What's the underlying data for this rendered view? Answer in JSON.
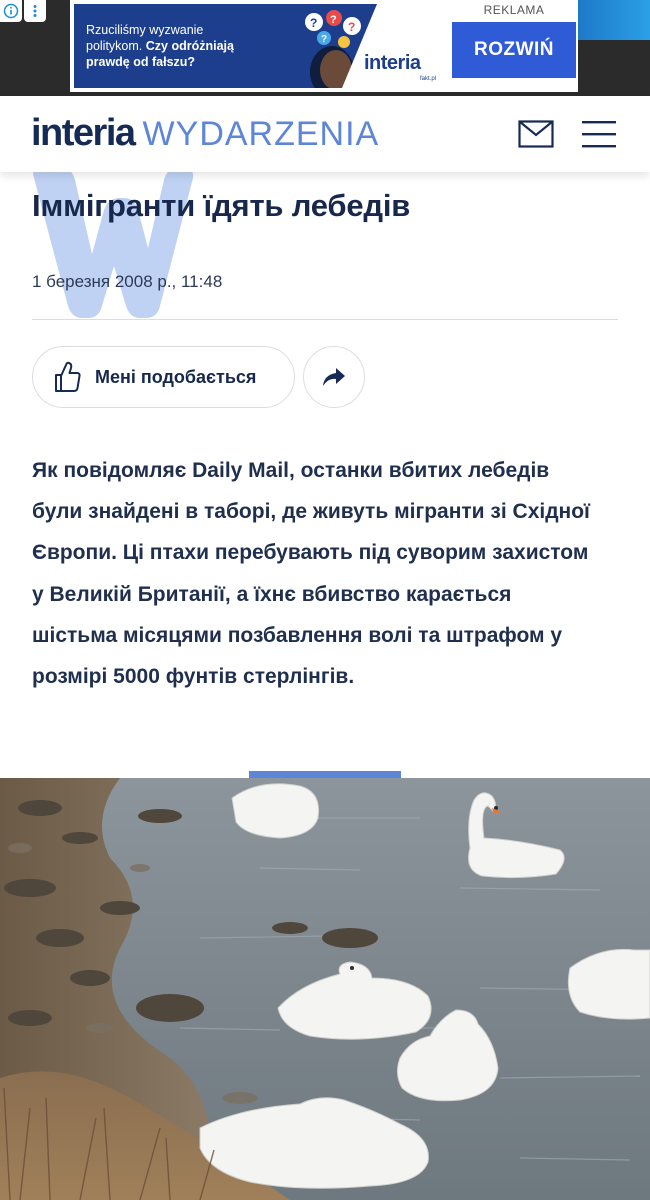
{
  "ad": {
    "teaser_line1": "Rzuciliśmy wyzwanie",
    "teaser_line2": "politykom.",
    "teaser_bold1": "Czy odróżniają",
    "teaser_bold2": "prawdę od fałszu?",
    "brand": "interia",
    "brand_sub": "fakt.pl",
    "sponsored_label": "REKLAMA",
    "cta_label": "ROZWIŃ",
    "info_icon": "info-icon",
    "more_icon": "more-vertical-icon"
  },
  "header": {
    "logo_main": "interia",
    "logo_section": "WYDARZENIA",
    "mail_icon": "mail-icon",
    "menu_icon": "hamburger-menu-icon"
  },
  "article": {
    "title": "Іммігранти їдять лебедів",
    "date": "1 березня 2008 р., 11:48",
    "like_label": "Мені подобається",
    "lead": "Як повідомляє Daily Mail, останки вбитих лебедів були знайдені в таборі, де живуть мігранти зі Східної Європи. Ці птахи перебувають під суворим захистом у Великій Британії, а їхнє вбивство карається шістьма місяцями позбавлення волі та штрафом у розмірі 5000 фунтів стерлінгів."
  },
  "colors": {
    "accent": "#5e86d8",
    "navy": "#152a55",
    "ad_blue": "#2f5bd6"
  }
}
